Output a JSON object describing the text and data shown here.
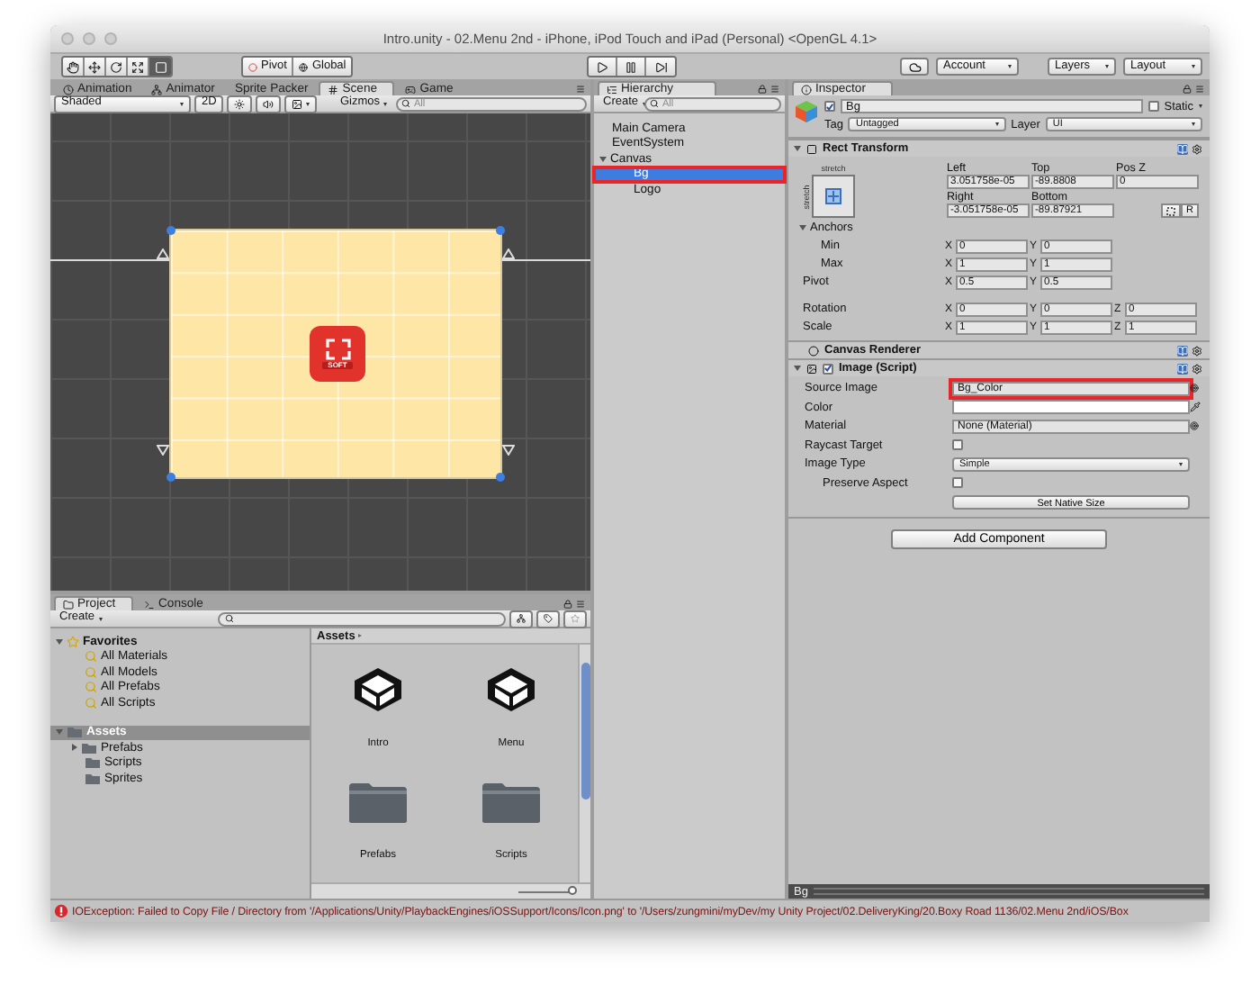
{
  "window": {
    "title": "Intro.unity - 02.Menu 2nd - iPhone, iPod Touch and iPad (Personal) <OpenGL 4.1>"
  },
  "toolbar": {
    "tools": [
      {
        "kind": "hand",
        "selected": false
      },
      {
        "kind": "move",
        "selected": false
      },
      {
        "kind": "rotate",
        "selected": false
      },
      {
        "kind": "scale",
        "selected": false
      },
      {
        "kind": "rect",
        "selected": true
      }
    ],
    "pivot": "Pivot",
    "space": "Global",
    "account": "Account",
    "layers": "Layers",
    "layout": "Layout"
  },
  "scene_panel": {
    "tabs": [
      {
        "kind": "animation",
        "label": "Animation",
        "selected": false
      },
      {
        "kind": "animator",
        "label": "Animator",
        "selected": false
      },
      {
        "kind": "sprite",
        "label": "Sprite Packer",
        "selected": false
      },
      {
        "kind": "scene",
        "label": "Scene",
        "selected": true
      },
      {
        "kind": "game",
        "label": "Game",
        "selected": false
      }
    ],
    "shading": "Shaded",
    "mode_2d": "2D",
    "gizmos": "Gizmos",
    "search": {
      "placeholder": "All"
    },
    "logo_text": "SOFT"
  },
  "hierarchy": {
    "title": "Hierarchy",
    "create": "Create",
    "search": {
      "placeholder": "All"
    },
    "items": [
      {
        "label": "Main Camera",
        "selected": false
      },
      {
        "label": "EventSystem",
        "selected": false
      },
      {
        "label": "Canvas",
        "selected": false,
        "expanded": true,
        "children": [
          {
            "label": "Bg",
            "selected": true,
            "annotated": true
          },
          {
            "label": "Logo",
            "selected": false
          }
        ]
      }
    ]
  },
  "inspector": {
    "title": "Inspector",
    "object": {
      "enabled": true,
      "name": "Bg",
      "static_label": "Static",
      "static": false,
      "tag_label": "Tag",
      "tag": "Untagged",
      "layer_label": "Layer",
      "layer": "UI"
    },
    "rect_transform": {
      "title": "Rect Transform",
      "expanded": true,
      "preset_top": "stretch",
      "preset_side": "stretch",
      "rows": [
        [
          {
            "label": "Left",
            "value": "3.051758e-05"
          },
          {
            "label": "Top",
            "value": "-89.8808"
          },
          {
            "label": "Pos Z",
            "value": "0"
          }
        ],
        [
          {
            "label": "Right",
            "value": "-3.051758e-05"
          },
          {
            "label": "Bottom",
            "value": "-89.87921"
          }
        ]
      ],
      "reset": "R",
      "anchors": {
        "label": "Anchors",
        "expanded": true,
        "rows": [
          {
            "label": "Min",
            "values": [
              {
                "axis": "X",
                "value": "0"
              },
              {
                "axis": "Y",
                "value": "0"
              }
            ]
          },
          {
            "label": "Max",
            "values": [
              {
                "axis": "X",
                "value": "1"
              },
              {
                "axis": "Y",
                "value": "1"
              }
            ]
          }
        ]
      },
      "vectors": [
        {
          "label": "Pivot",
          "values": [
            {
              "axis": "X",
              "value": "0.5"
            },
            {
              "axis": "Y",
              "value": "0.5"
            }
          ]
        },
        {
          "label": "Rotation",
          "values": [
            {
              "axis": "X",
              "value": "0"
            },
            {
              "axis": "Y",
              "value": "0"
            },
            {
              "axis": "Z",
              "value": "0"
            }
          ]
        },
        {
          "label": "Scale",
          "values": [
            {
              "axis": "X",
              "value": "1"
            },
            {
              "axis": "Y",
              "value": "1"
            },
            {
              "axis": "Z",
              "value": "1"
            }
          ]
        }
      ]
    },
    "canvas_renderer": {
      "title": "Canvas Renderer"
    },
    "image_script": {
      "title": "Image (Script)",
      "expanded": true,
      "enabled": true,
      "rows": [
        {
          "kind": "object",
          "label": "Source Image",
          "value": "Bg_Color",
          "annotated": true
        },
        {
          "kind": "color",
          "label": "Color"
        },
        {
          "kind": "object",
          "label": "Material",
          "value": "None (Material)",
          "annotated": false
        },
        {
          "kind": "checkbox",
          "label": "Raycast Target",
          "checked": false
        },
        {
          "kind": "dropdown",
          "label": "Image Type",
          "value": "Simple"
        },
        {
          "kind": "checkbox",
          "label": "Preserve Aspect",
          "checked": false,
          "indented": true
        },
        {
          "kind": "button",
          "label": "Set Native Size"
        }
      ]
    },
    "add_component": "Add Component",
    "preview": "Bg"
  },
  "project": {
    "tabs": [
      {
        "kind": "project",
        "label": "Project",
        "selected": true
      },
      {
        "kind": "console",
        "label": "Console",
        "selected": false
      }
    ],
    "create": "Create",
    "tree": [
      {
        "kind": "favorites",
        "label": "Favorites",
        "selected": false,
        "expanded": true,
        "children": [
          {
            "kind": "search",
            "label": "All Materials",
            "selected": false
          },
          {
            "kind": "search",
            "label": "All Models",
            "selected": false
          },
          {
            "kind": "search",
            "label": "All Prefabs",
            "selected": false
          },
          {
            "kind": "search",
            "label": "All Scripts",
            "selected": false
          }
        ]
      },
      {
        "kind": "folder",
        "label": "Assets",
        "selected": true,
        "expanded": true,
        "children": [
          {
            "kind": "folder",
            "label": "Prefabs",
            "selected": false,
            "expanded": false
          },
          {
            "kind": "folder",
            "label": "Scripts",
            "selected": false
          },
          {
            "kind": "folder",
            "label": "Sprites",
            "selected": false
          }
        ]
      }
    ],
    "breadcrumb": "Assets",
    "assets": [
      {
        "kind": "scene",
        "label": "Intro"
      },
      {
        "kind": "scene",
        "label": "Menu"
      },
      {
        "kind": "folder",
        "label": "Prefabs"
      },
      {
        "kind": "folder",
        "label": "Scripts"
      }
    ],
    "zoom": {
      "level": 0.95
    }
  },
  "status_bar": {
    "message": "IOException: Failed to Copy File / Directory from '/Applications/Unity/PlaybackEngines/iOSSupport/Icons/Icon.png' to '/Users/zungmini/myDev/my Unity Project/02.DeliveryKing/20.Boxy Road 1136/02.Menu 2nd/iOS/Box"
  }
}
